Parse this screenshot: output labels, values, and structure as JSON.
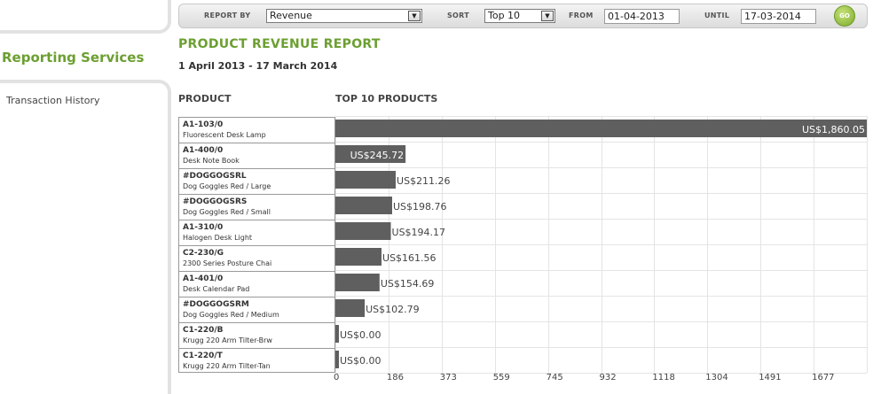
{
  "sidebar": {
    "section_title": "Reporting Services",
    "items": [
      {
        "label": "Transaction History"
      }
    ]
  },
  "toolbar": {
    "report_by_label": "REPORT BY",
    "report_by_value": "Revenue",
    "sort_label": "SORT",
    "sort_value": "Top 10",
    "from_label": "FROM",
    "from_value": "01-04-2013",
    "until_label": "UNTIL",
    "until_value": "17-03-2014",
    "go_label": "GO"
  },
  "report": {
    "title": "PRODUCT REVENUE REPORT",
    "date_range": "1 April 2013 - 17 March 2014",
    "col_product": "PRODUCT",
    "col_chart": "TOP 10 PRODUCTS"
  },
  "products": [
    {
      "code": "A1-103/0",
      "name": "Fluorescent Desk Lamp"
    },
    {
      "code": "A1-400/0",
      "name": "Desk Note Book"
    },
    {
      "code": "#DOGGOGSRL",
      "name": "Dog Goggles Red / Large"
    },
    {
      "code": "#DOGGOGSRS",
      "name": "Dog Goggles Red / Small"
    },
    {
      "code": "A1-310/0",
      "name": "Halogen Desk Light"
    },
    {
      "code": "C2-230/G",
      "name": "2300 Series Posture Chai"
    },
    {
      "code": "A1-401/0",
      "name": "Desk Calendar Pad"
    },
    {
      "code": "#DOGGOGSRM",
      "name": "Dog Goggles Red / Medium"
    },
    {
      "code": "C1-220/B",
      "name": "Krugg 220 Arm Tilter-Brw"
    },
    {
      "code": "C1-220/T",
      "name": "Krugg 220 Arm Tilter-Tan"
    }
  ],
  "chart_data": {
    "type": "bar",
    "orientation": "horizontal",
    "categories": [
      "A1-103/0",
      "A1-400/0",
      "#DOGGOGSRL",
      "#DOGGOGSRS",
      "A1-310/0",
      "C2-230/G",
      "A1-401/0",
      "#DOGGOGSRM",
      "C1-220/B",
      "C1-220/T"
    ],
    "values": [
      1860.05,
      245.72,
      211.26,
      198.76,
      194.17,
      161.56,
      154.69,
      102.79,
      0.0,
      0.0
    ],
    "labels": [
      "US$1,860.05",
      "US$245.72",
      "US$211.26",
      "US$198.76",
      "US$194.17",
      "US$161.56",
      "US$154.69",
      "US$102.79",
      "US$0.00",
      "US$0.00"
    ],
    "xticks": [
      "0",
      "186",
      "373",
      "559",
      "745",
      "932",
      "1118",
      "1304",
      "1491",
      "1677"
    ],
    "xlim": [
      0,
      1860.05
    ],
    "grid": true,
    "bar_color": "#5f5f5f",
    "grid_color": "#e4e4e4"
  }
}
